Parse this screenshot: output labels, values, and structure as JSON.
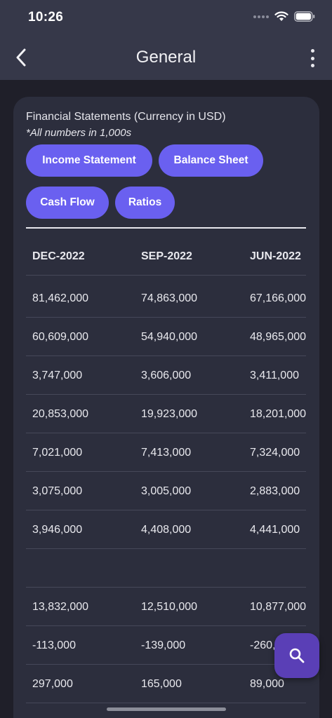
{
  "status": {
    "time": "10:26"
  },
  "header": {
    "title": "General"
  },
  "card": {
    "title": "Financial Statements (Currency in USD)",
    "subtitle": "*All numbers in 1,000s",
    "chips": [
      "Income Statement",
      "Balance Sheet",
      "Cash Flow",
      "Ratios"
    ]
  },
  "table": {
    "headers": [
      "DEC-2022",
      "SEP-2022",
      "JUN-2022"
    ],
    "rows": [
      [
        "81,462,000",
        "74,863,000",
        "67,166,000"
      ],
      [
        "60,609,000",
        "54,940,000",
        "48,965,000"
      ],
      [
        "3,747,000",
        "3,606,000",
        "3,411,000"
      ],
      [
        "20,853,000",
        "19,923,000",
        "18,201,000"
      ],
      [
        "7,021,000",
        "7,413,000",
        "7,324,000"
      ],
      [
        "3,075,000",
        "3,005,000",
        "2,883,000"
      ],
      [
        "3,946,000",
        "4,408,000",
        "4,441,000"
      ],
      [
        "",
        "",
        ""
      ],
      [
        "13,832,000",
        "12,510,000",
        "10,877,000"
      ],
      [
        "-113,000",
        "-139,000",
        "-260,000"
      ],
      [
        "297,000",
        "165,000",
        "89,000"
      ]
    ]
  },
  "icons": {
    "back": "chevron-left-icon",
    "more": "more-vertical-icon",
    "search": "search-icon",
    "wifi": "wifi-icon",
    "battery": "battery-icon"
  },
  "colors": {
    "accent": "#6a60f0",
    "fab": "#5a3fb6",
    "background": "#1f1f29",
    "card": "#2c2e3d"
  }
}
